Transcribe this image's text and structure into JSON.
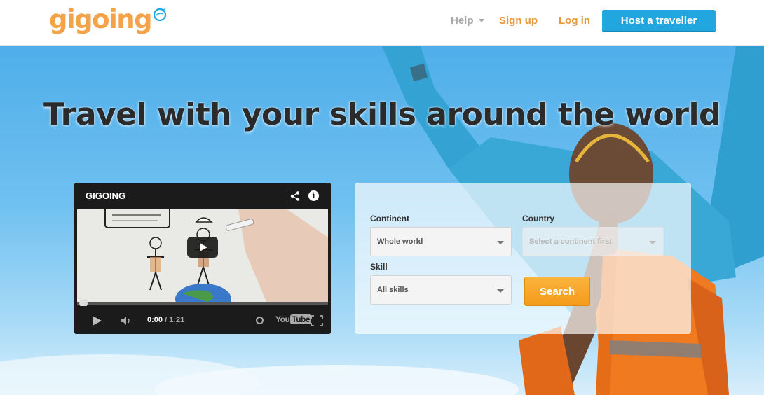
{
  "header": {
    "logo_text": "gigoing",
    "nav": {
      "help": "Help",
      "signup": "Sign up",
      "login": "Log in",
      "host": "Host a traveller"
    }
  },
  "hero": {
    "title": "Travel with your skills around the world"
  },
  "video": {
    "title": "GIGOING",
    "time_current": "0:00",
    "time_total": "/ 1:21",
    "youtube_label": "You",
    "youtube_tube": "Tube",
    "progress_fraction": 0.0
  },
  "search": {
    "continent_label": "Continent",
    "continent_value": "Whole world",
    "country_label": "Country",
    "country_placeholder": "Select a continent first",
    "skill_label": "Skill",
    "skill_value": "All skills",
    "search_button": "Search"
  },
  "colors": {
    "brand_orange": "#f5a34a",
    "host_button_blue": "#21a6e0",
    "search_button_orange": "#f49a1a",
    "nav_orange": "#e8973a"
  },
  "icons": {
    "logo_mark": "globe-plane-icon",
    "share": "share-icon",
    "info": "info-icon",
    "play": "play-icon",
    "volume": "volume-icon",
    "clock": "watch-later-icon",
    "fullscreen": "fullscreen-icon"
  }
}
